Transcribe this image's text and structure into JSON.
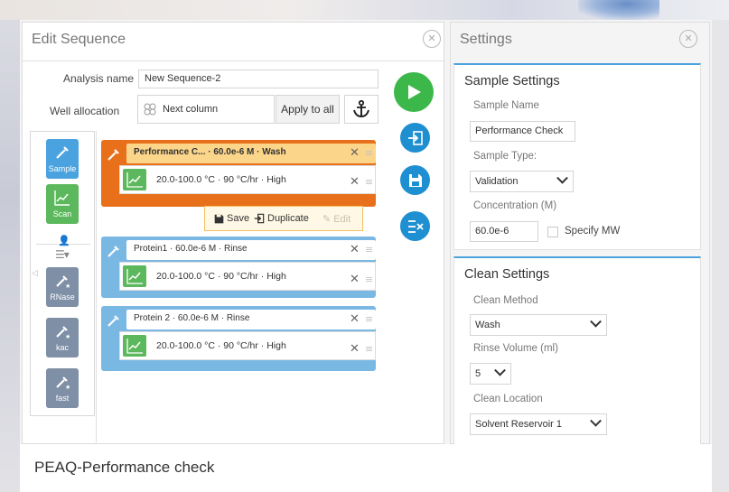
{
  "caption": "PEAQ-Performance check",
  "colors": {
    "accent_blue": "#1e8fd0",
    "play_green": "#3cb84a",
    "sample_orange": "#e8701a",
    "sample_blue": "#7ab8e4",
    "scan_green": "#5cb85c",
    "method_gray": "#7e8fa6",
    "highlight_bar": "#fbd58a"
  },
  "edit_sequence": {
    "title": "Edit Sequence",
    "analysis_name_label": "Analysis name",
    "analysis_name_value": "New Sequence-2",
    "well_allocation_label": "Well allocation",
    "well_allocation_value": "Next column",
    "apply_to_all": "Apply to all",
    "sidebar": {
      "sample_label": "Sample",
      "scan_label": "Scan",
      "methods": [
        {
          "label": "RNase"
        },
        {
          "label": "kac"
        },
        {
          "label": "fast"
        }
      ]
    },
    "samples": [
      {
        "header": "Performance C... · 60.0e-6 M · Wash",
        "scan": "20.0-100.0 °C · 90 °C/hr · High"
      },
      {
        "header": "Protein1 · 60.0e-6 M · Rinse",
        "scan": "20.0-100.0 °C · 90 °C/hr · High"
      },
      {
        "header": "Protein 2 · 60.0e-6 M · Rinse",
        "scan": "20.0-100.0 °C · 90 °C/hr · High"
      }
    ],
    "context_menu": {
      "save": "Save",
      "duplicate": "Duplicate",
      "edit": "Edit"
    }
  },
  "settings": {
    "title": "Settings",
    "sample_settings": {
      "title": "Sample Settings",
      "sample_name_label": "Sample Name",
      "sample_name_value": "Performance Check",
      "sample_type_label": "Sample Type:",
      "sample_type_value": "Validation",
      "concentration_label": "Concentration (M)",
      "concentration_value": "60.0e-6",
      "specify_mw_label": "Specify MW"
    },
    "clean_settings": {
      "title": "Clean Settings",
      "clean_method_label": "Clean Method",
      "clean_method_value": "Wash",
      "rinse_volume_label": "Rinse Volume (ml)",
      "rinse_volume_value": "5",
      "clean_location_label": "Clean Location",
      "clean_location_value": "Solvent Reservoir 1"
    }
  }
}
